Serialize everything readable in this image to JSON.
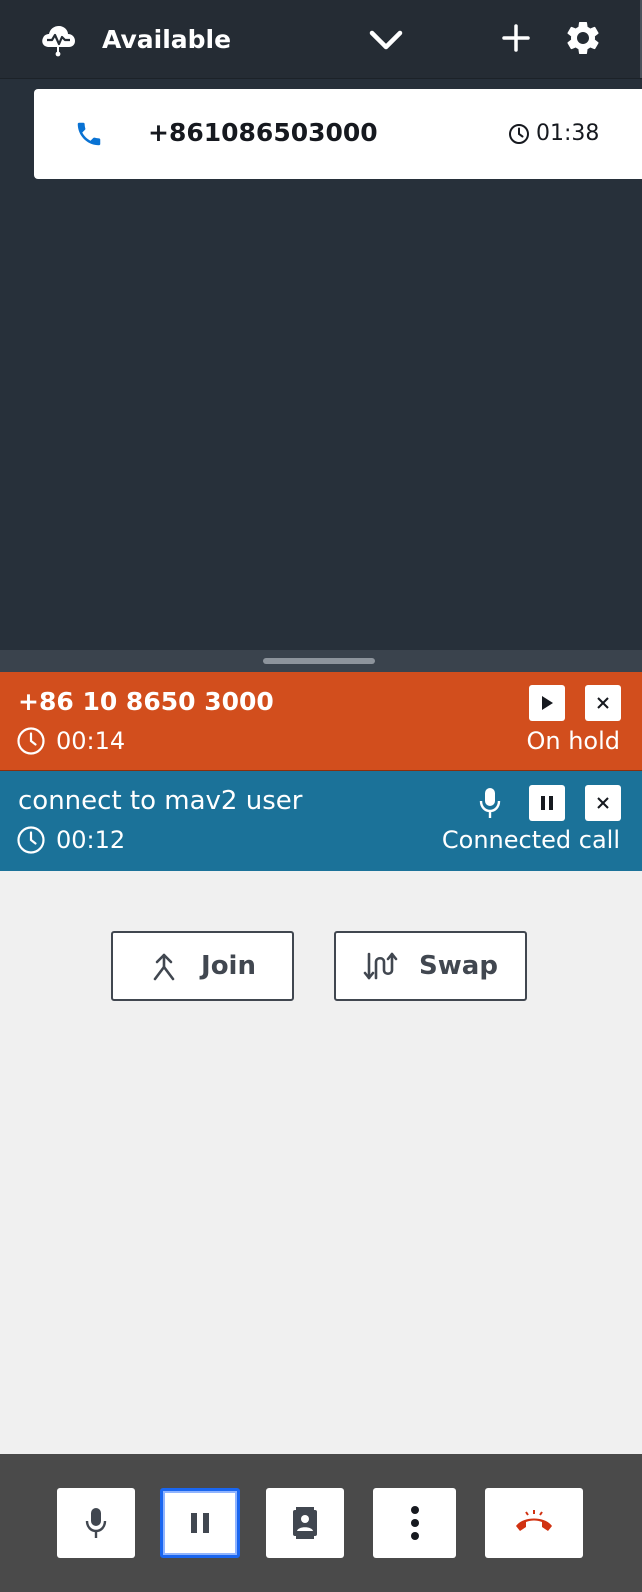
{
  "header": {
    "status_label": "Available",
    "icons": {
      "status": "cloud-waveform-icon",
      "dropdown": "chevron-down-icon",
      "add": "plus-icon",
      "settings": "gear-icon"
    }
  },
  "contact_card": {
    "number": "+861086503000",
    "timer": "01:38",
    "icons": {
      "phone": "phone-icon",
      "clock": "clock-icon"
    }
  },
  "calls": [
    {
      "name": "+86 10 8650 3000",
      "timer": "00:14",
      "state": "On hold",
      "color": "#d24e1d",
      "actions": [
        "resume-icon",
        "close-icon"
      ]
    },
    {
      "name": "connect to mav2 user",
      "timer": "00:12",
      "state": "Connected call",
      "color": "#1b7299",
      "actions": [
        "microphone-icon",
        "pause-icon",
        "close-icon"
      ]
    }
  ],
  "actions": {
    "join_label": "Join",
    "swap_label": "Swap"
  },
  "footer": {
    "buttons": [
      "microphone-icon",
      "pause-icon",
      "contacts-icon",
      "more-vertical-icon",
      "hang-up-icon"
    ],
    "selected": "pause-icon",
    "end_call_color": "#d13212"
  },
  "colors": {
    "header_bg": "#252c34",
    "panel_bg": "#27303a",
    "accent_blue": "#1a66f0",
    "phone_icon_blue": "#0972d3"
  }
}
